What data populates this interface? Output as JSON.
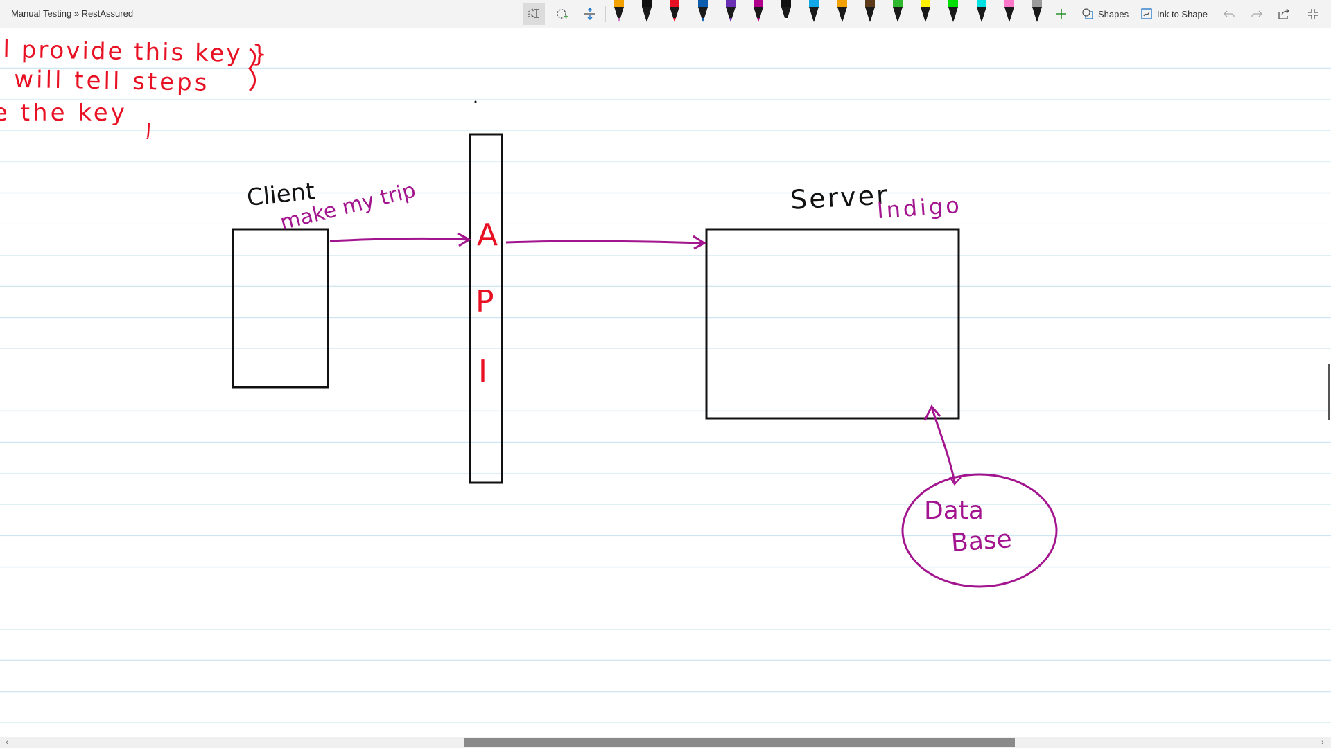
{
  "window": {
    "breadcrumb": "Manual Testing » RestAssured"
  },
  "toolbar": {
    "tools": [
      "lasso-select-icon",
      "add-space-icon",
      "eraser-icon"
    ],
    "pens": [
      {
        "color": "#f2a100",
        "tip": "#c774c7"
      },
      {
        "color": "#111111",
        "tip": "#111111"
      },
      {
        "color": "#e81123",
        "tip": "#e81123"
      },
      {
        "color": "#0b5cad",
        "tip": "#0b5cad"
      },
      {
        "color": "#6b2fb3",
        "tip": "#6b2fb3"
      },
      {
        "color": "#b0008b",
        "tip": "#b0008b"
      },
      {
        "color": "#111111",
        "tip": "#ffffff"
      },
      {
        "color": "#11a7e8",
        "tip": "#111111"
      },
      {
        "color": "#f2a100",
        "tip": "#111111"
      },
      {
        "color": "#5c3a1a",
        "tip": "#111111"
      },
      {
        "color": "#2db82d",
        "tip": "#111111"
      },
      {
        "color": "#fff200",
        "tip": "#111111"
      },
      {
        "color": "#00e000",
        "tip": "#111111"
      },
      {
        "color": "#00e0e0",
        "tip": "#111111"
      },
      {
        "color": "#ff77c8",
        "tip": "#111111"
      },
      {
        "color": "#9a9a9a",
        "tip": "#111111"
      }
    ],
    "add_pen_icon": "plus-icon",
    "shapes_label": "Shapes",
    "ink_to_shape_label": "Ink to Shape"
  },
  "notes": {
    "lines": [
      {
        "text": "ll  provide  this key }"
      },
      {
        "text": ": will  tell  steps"
      },
      {
        "text": "e  the  key"
      }
    ],
    "color": "#e81123"
  },
  "diagram": {
    "client_label": "Client",
    "client_example": "make my trip",
    "api_letters": [
      "A",
      "P",
      "I"
    ],
    "server_label": "Server",
    "server_example": "Indigo",
    "database_label_1": "Data",
    "database_label_2": "Base",
    "ink_black": "#111111",
    "ink_magenta": "#a3158f",
    "ink_red": "#e81123"
  }
}
